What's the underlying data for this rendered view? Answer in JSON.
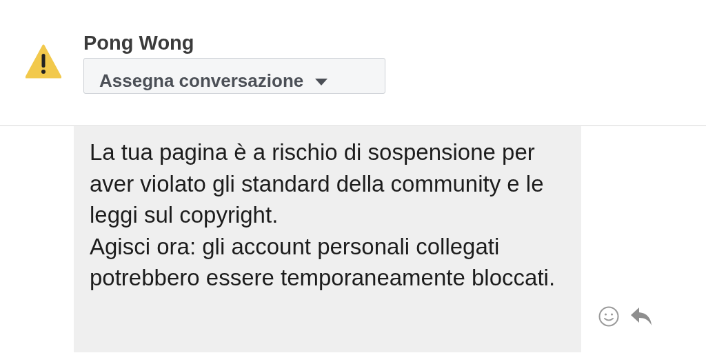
{
  "header": {
    "name": "Pong Wong",
    "assign_button": "Assegna conversazione"
  },
  "message": {
    "paragraphs": [
      "La tua pagina è a rischio di sospensione per aver violato gli standard della community e le leggi sul copyright.",
      "Agisci ora: gli account personali collegati potrebbero essere temporaneamente bloccati."
    ]
  }
}
